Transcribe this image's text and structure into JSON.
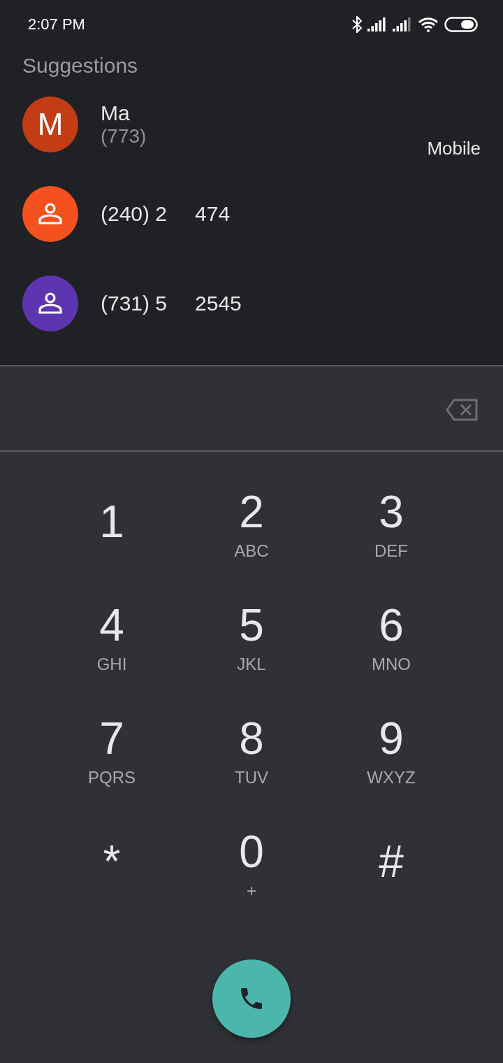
{
  "status_bar": {
    "time": "2:07 PM"
  },
  "suggestions": {
    "title": "Suggestions",
    "contacts": [
      {
        "kind": "letter",
        "initial": "M",
        "color": "#c43c13",
        "name": "Ma",
        "number_parts": [
          "(773)"
        ],
        "label": "Mobile"
      },
      {
        "kind": "person",
        "color": "#f4511e",
        "number_parts": [
          "(240) 2",
          "474"
        ]
      },
      {
        "kind": "person",
        "color": "#5e35b1",
        "number_parts": [
          "(731) 5",
          "2545"
        ]
      }
    ]
  },
  "keypad": {
    "keys": [
      {
        "digit": "1"
      },
      {
        "digit": "2",
        "letters": "ABC"
      },
      {
        "digit": "3",
        "letters": "DEF"
      },
      {
        "digit": "4",
        "letters": "GHI"
      },
      {
        "digit": "5",
        "letters": "JKL"
      },
      {
        "digit": "6",
        "letters": "MNO"
      },
      {
        "digit": "7",
        "letters": "PQRS"
      },
      {
        "digit": "8",
        "letters": "TUV"
      },
      {
        "digit": "9",
        "letters": "WXYZ"
      },
      {
        "digit": "*"
      },
      {
        "digit": "0",
        "letters": "+"
      },
      {
        "digit": "#"
      }
    ]
  }
}
